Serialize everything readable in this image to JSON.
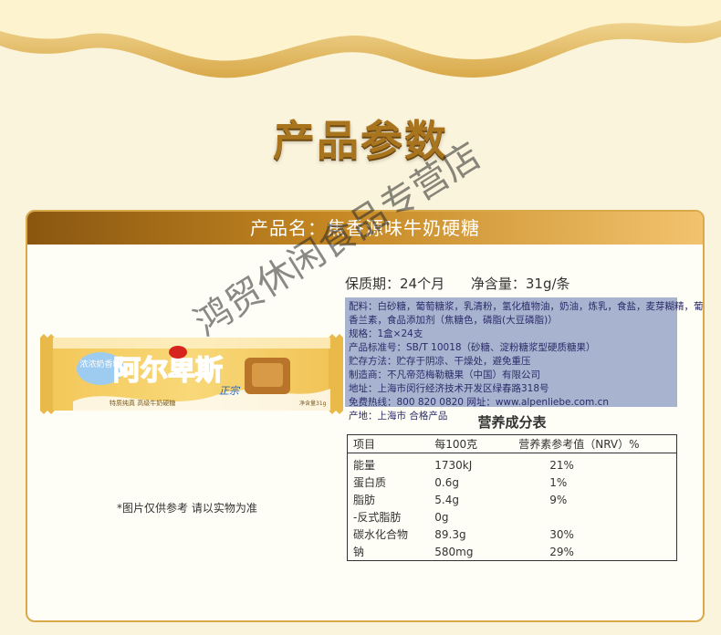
{
  "page_title": "产品参数",
  "product_name": "产品名：焦香源味牛奶硬糖",
  "meta": {
    "shelf_life": "保质期：24个月",
    "net_content": "净含量：31g/条"
  },
  "info_lines": [
    "配料：白砂糖，葡萄糖浆，乳清粉，氢化植物油，奶油，炼乳，食盐，麦芽糊精，葡萄糖，",
    "香兰素，食品添加剂（焦糖色，磷脂(大豆磷脂)）",
    "规格：1盒×24支",
    "产品标准号：SB/T 10018（砂糖、淀粉糖浆型硬质糖果）",
    "贮存方法：贮存于阴凉、干燥处，避免重压",
    "制造商：不凡帝范梅勒糖果（中国）有限公司",
    "地址：上海市闵行经济技术开发区绿春路318号",
    "免费热线：800 820 0820 网址：www.alpenliebe.com.cn",
    "产地：上海市 合格产品"
  ],
  "candy": {
    "brand": "阿尔卑斯",
    "sub_brand": "正宗",
    "badge": "浓浓奶香精",
    "tagline": "特质纯真 高级牛奶硬糖",
    "weight": "净含量31g"
  },
  "note": "*图片仅供参考 请以实物为准",
  "nutrition": {
    "title": "营养成分表",
    "headers": [
      "项目",
      "每100克",
      "营养素参考值（NRV）%"
    ],
    "rows": [
      [
        "能量",
        "1730kJ",
        "21%"
      ],
      [
        "蛋白质",
        "0.6g",
        "1%"
      ],
      [
        "脂肪",
        "5.4g",
        "9%"
      ],
      [
        "-反式脂肪",
        "0g",
        ""
      ],
      [
        "碳水化合物",
        "89.3g",
        "30%"
      ],
      [
        "钠",
        "580mg",
        "29%"
      ]
    ]
  },
  "watermark": "鸿贸休闲食品专营店",
  "colors": {
    "gold": "#c48722",
    "title": "#a8741e",
    "info_bg": "#a8b4cf"
  }
}
